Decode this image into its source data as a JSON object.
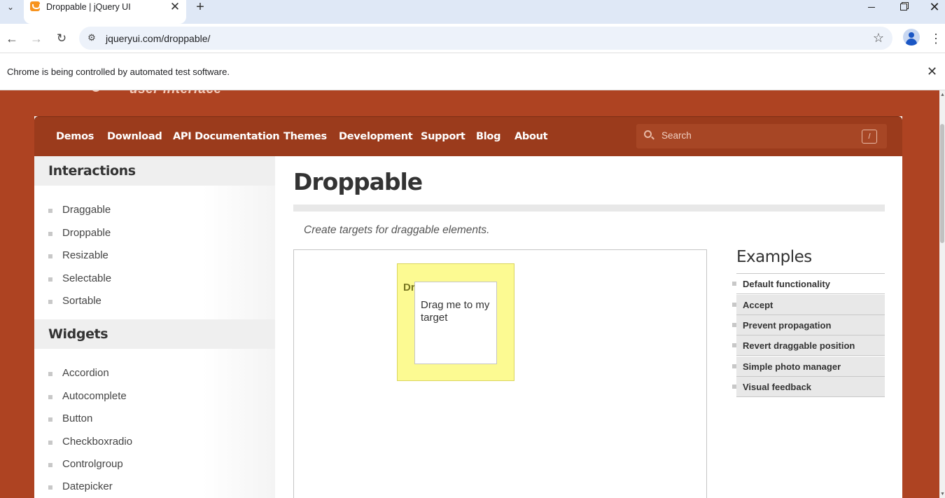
{
  "browser": {
    "tab_title": "Droppable | jQuery UI",
    "url": "jqueryui.com/droppable/",
    "infobar_text": "Chrome is being controlled by automated test software."
  },
  "site": {
    "logo_tagline": "user interface",
    "nav": [
      "Demos",
      "Download",
      "API Documentation",
      "Themes",
      "Development",
      "Support",
      "Blog",
      "About"
    ],
    "search": {
      "placeholder": "Search",
      "shortcut": "/"
    }
  },
  "sidebar": {
    "sections": [
      {
        "heading": "Interactions",
        "items": [
          "Draggable",
          "Droppable",
          "Resizable",
          "Selectable",
          "Sortable"
        ]
      },
      {
        "heading": "Widgets",
        "items": [
          "Accordion",
          "Autocomplete",
          "Button",
          "Checkboxradio",
          "Controlgroup",
          "Datepicker"
        ]
      }
    ]
  },
  "main": {
    "title": "Droppable",
    "subtitle": "Create targets for draggable elements.",
    "demo": {
      "droppable_label": "Drop here",
      "draggable_label": "Drag me to my target"
    },
    "examples": {
      "heading": "Examples",
      "items": [
        "Default functionality",
        "Accept",
        "Prevent propagation",
        "Revert draggable position",
        "Simple photo manager",
        "Visual feedback"
      ]
    }
  },
  "icons": {
    "tab_dropdown": "chevron-down-icon",
    "new_tab": "plus-icon",
    "back": "arrow-left-icon",
    "forward": "arrow-right-icon",
    "reload": "reload-icon",
    "bookmark": "star-icon",
    "menu": "kebab-menu-icon",
    "search": "search-icon"
  },
  "colors": {
    "site_background": "#ae4322",
    "nav_background": "#9b3b1c",
    "droppable_background": "#fcfa92"
  }
}
